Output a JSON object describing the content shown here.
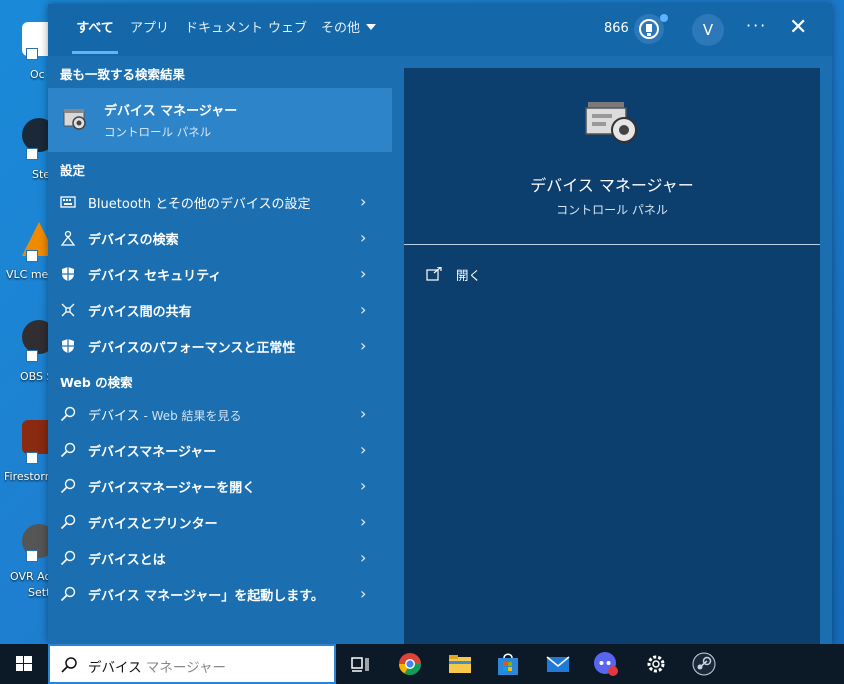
{
  "desktop": {
    "icons": [
      {
        "label": "Oc",
        "color": "#ffffff"
      },
      {
        "label": "Stea",
        "color": "#1b2838"
      },
      {
        "label": "VLC med",
        "color": "#f08a00"
      },
      {
        "label": "OBS S",
        "color": "#302e31"
      },
      {
        "label": "Firestorm",
        "color": "#8a2a10"
      },
      {
        "label": "OVR Ad",
        "color": "#555555"
      }
    ],
    "icon_labels_extra": [
      "Sett"
    ]
  },
  "search_window": {
    "tabs": [
      {
        "label": "すべて",
        "active": true
      },
      {
        "label": "アプリ",
        "active": false
      },
      {
        "label": "ドキュメント",
        "active": false
      },
      {
        "label": "ウェブ",
        "active": false
      },
      {
        "label": "その他",
        "active": false,
        "dropdown": true
      }
    ],
    "points": "866",
    "avatar_initial": "V",
    "more_label": "···",
    "close_label": "✕",
    "best_match_header": "最も一致する検索結果",
    "best_match": {
      "title": "デバイス マネージャー",
      "subtitle": "コントロール パネル",
      "icon": "device-manager-icon"
    },
    "settings_header": "設定",
    "settings_items": [
      {
        "label": "Bluetooth とその他のデバイスの設定",
        "icon": "keyboard-icon"
      },
      {
        "label": "デバイスの検索",
        "icon": "person-location-icon"
      },
      {
        "label": "デバイス セキュリティ",
        "icon": "shield-icon"
      },
      {
        "label": "デバイス間の共有",
        "icon": "share-icon"
      },
      {
        "label": "デバイスのパフォーマンスと正常性",
        "icon": "shield-icon"
      }
    ],
    "web_header": "Web の検索",
    "web_items": [
      {
        "label": "デバイス",
        "suffix": " - Web 結果を見る"
      },
      {
        "label": "デバイスマネージャー",
        "suffix": ""
      },
      {
        "label": "デバイスマネージャーを開く",
        "suffix": ""
      },
      {
        "label": "デバイスとプリンター",
        "suffix": ""
      },
      {
        "label": "デバイスとは",
        "suffix": ""
      },
      {
        "label": "デバイス マネージャー」を起動します。",
        "suffix": ""
      }
    ],
    "chevron": "›",
    "preview": {
      "title": "デバイス マネージャー",
      "subtitle": "コントロール パネル",
      "open_label": "開く"
    }
  },
  "taskbar": {
    "search_typed": "デバイス",
    "search_suggestion": " マネージャー",
    "apps": [
      "task-view-icon",
      "chrome-icon",
      "file-explorer-icon",
      "store-icon",
      "mail-icon",
      "discord-icon",
      "settings-gear-icon",
      "steam-icon"
    ]
  },
  "colors": {
    "window_bg": "#1b6fb0",
    "topbar_bg": "#1467a8",
    "selected_row": "#2e84c8",
    "preview_bg": "#0d3f6e",
    "taskbar_bg": "#0c1a28",
    "accent": "#5fb3ff"
  }
}
